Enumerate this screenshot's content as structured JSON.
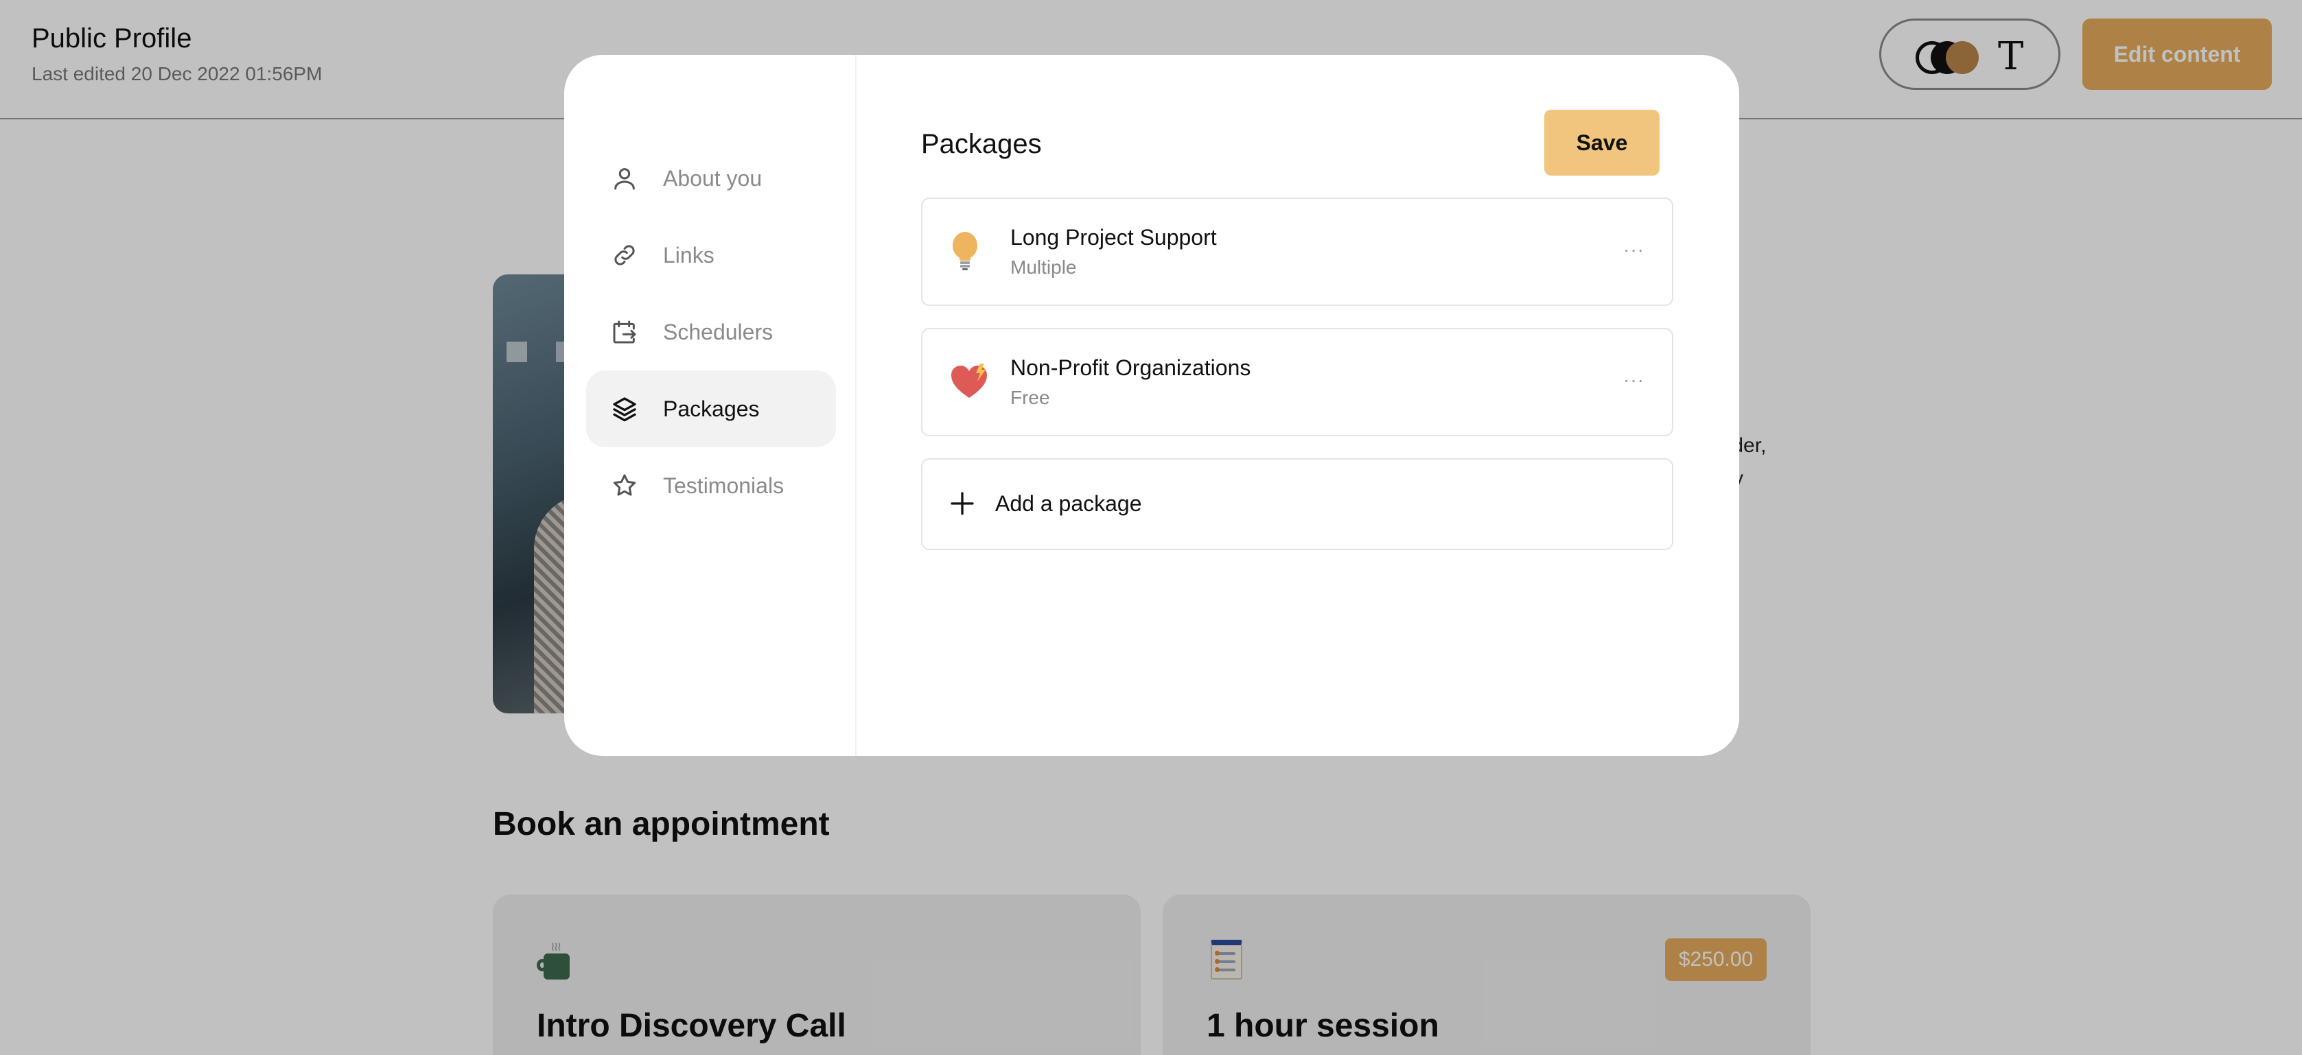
{
  "header": {
    "title": "Public Profile",
    "last_edited": "Last edited 20 Dec 2022 01:56PM",
    "theme_toggle_letter": "T",
    "edit_button": "Edit content",
    "accent_color": "#e6ac5e"
  },
  "profile": {
    "bio_lines": [
      "eader,",
      "tory"
    ]
  },
  "appointments": {
    "title": "Book an appointment",
    "cards": [
      {
        "title": "Intro Discovery Call",
        "icon": "coffee-mug-icon"
      },
      {
        "title": "1 hour session",
        "price": "$250.00",
        "icon": "checklist-icon"
      }
    ]
  },
  "modal": {
    "nav": [
      {
        "label": "About you",
        "icon": "user-icon",
        "active": false
      },
      {
        "label": "Links",
        "icon": "link-icon",
        "active": false
      },
      {
        "label": "Schedulers",
        "icon": "calendar-arrow-icon",
        "active": false
      },
      {
        "label": "Packages",
        "icon": "layers-icon",
        "active": true
      },
      {
        "label": "Testimonials",
        "icon": "star-icon",
        "active": false
      }
    ],
    "title": "Packages",
    "save_button": "Save",
    "save_color": "#f1c57e",
    "packages": [
      {
        "name": "Long Project Support",
        "type": "Multiple",
        "icon": "lightbulb-icon",
        "more": "···"
      },
      {
        "name": "Non-Profit Organizations",
        "type": "Free",
        "icon": "heart-icon",
        "more": "···"
      }
    ],
    "add_package": "Add a package"
  }
}
